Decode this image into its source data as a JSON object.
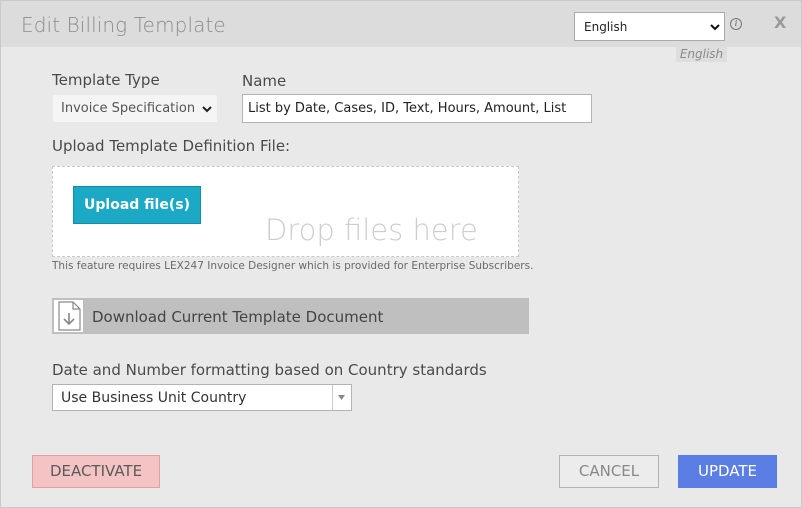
{
  "dialog": {
    "title": "Edit Billing Template",
    "language_select": {
      "value": "English",
      "tooltip": "English"
    },
    "info_icon_glyph": "i",
    "close_label": "X"
  },
  "form": {
    "template_type_label": "Template Type",
    "template_type_value": "Invoice Specification",
    "name_label": "Name",
    "name_value": "List by Date, Cases, ID, Text, Hours, Amount, List",
    "upload_label": "Upload Template Definition File:",
    "upload_button": "Upload file(s)",
    "drop_text": "Drop files here",
    "note": "This feature requires LEX247 Invoice Designer which is provided for Enterprise Subscribers.",
    "download_label": "Download Current Template Document",
    "formatting_label": "Date and Number formatting based on Country standards",
    "formatting_value": "Use Business Unit Country"
  },
  "footer": {
    "deactivate": "DEACTIVATE",
    "cancel": "CANCEL",
    "update": "UPDATE"
  },
  "colors": {
    "upload_button": "#1ba9c6",
    "update_button": "#5b7ee5",
    "deactivate_button": "#f4c4c4"
  },
  "icons": [
    "info-icon",
    "close-icon",
    "download-icon",
    "chevron-down-icon"
  ]
}
